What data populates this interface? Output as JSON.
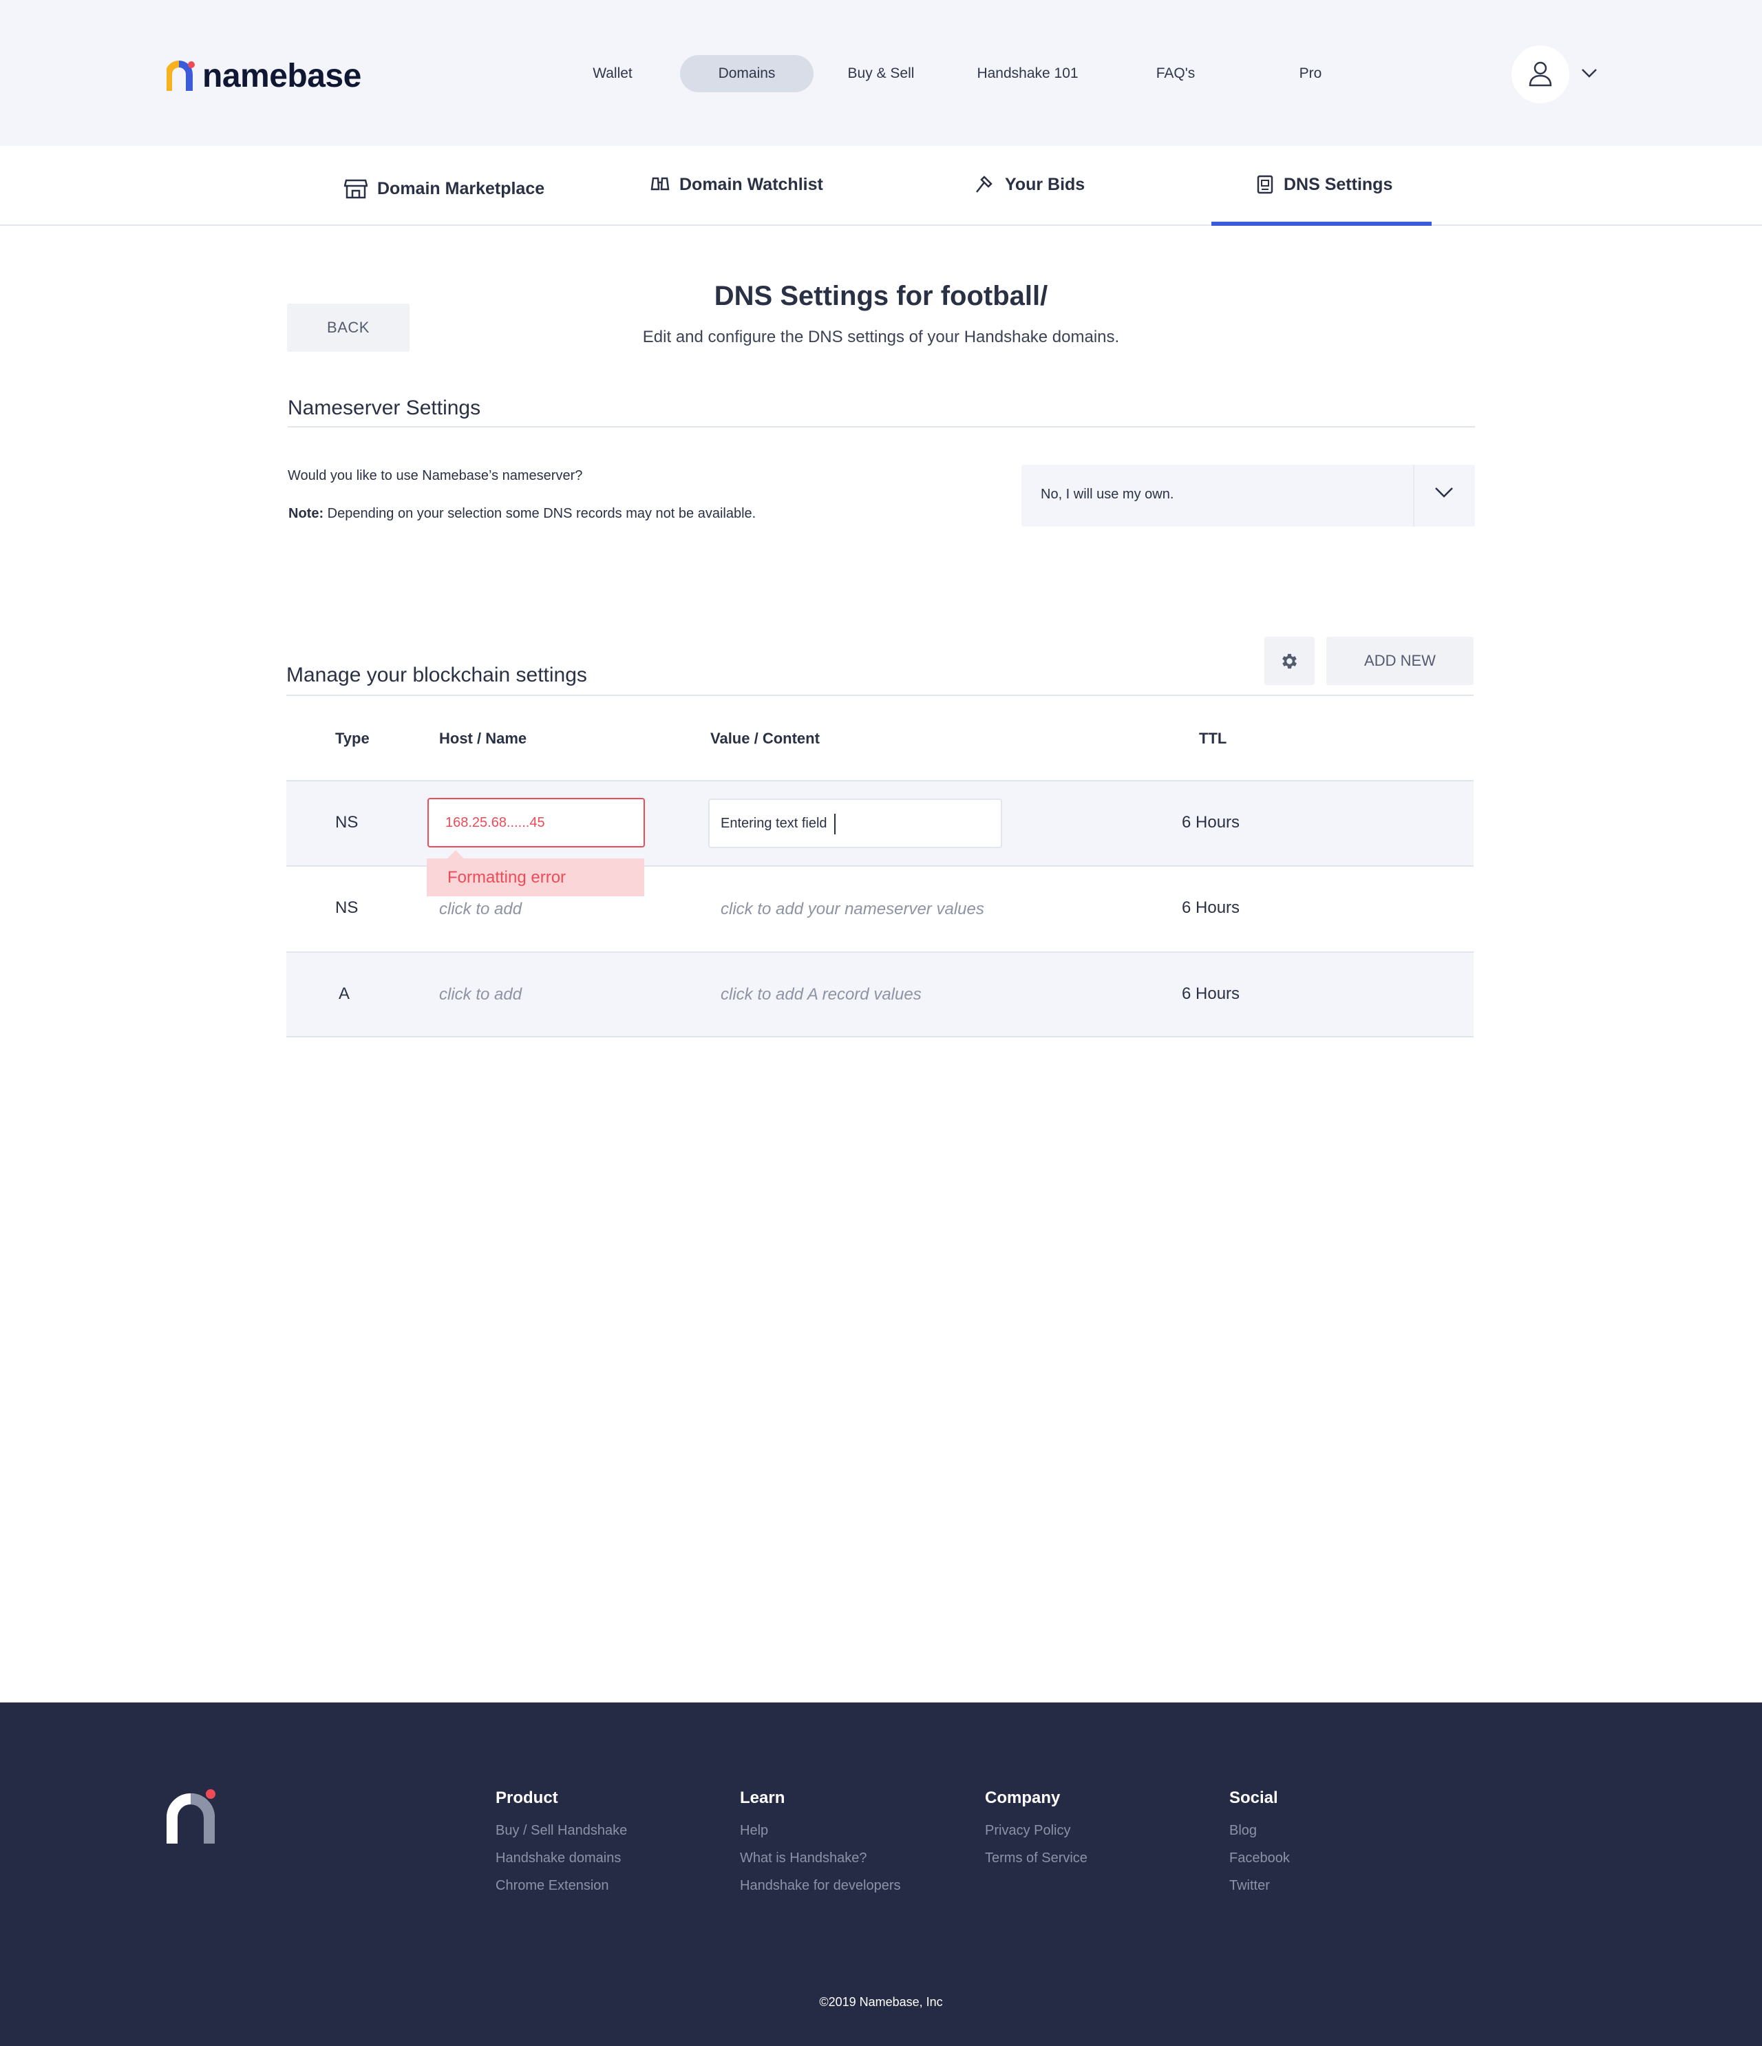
{
  "brand": {
    "name": "namebase"
  },
  "nav": {
    "items": [
      {
        "label": "Wallet"
      },
      {
        "label": "Domains"
      },
      {
        "label": "Buy & Sell"
      },
      {
        "label": "Handshake 101"
      },
      {
        "label": "FAQ's"
      },
      {
        "label": "Pro"
      }
    ],
    "active": "Domains"
  },
  "subtabs": [
    {
      "label": "Domain Marketplace",
      "icon": "storefront-icon"
    },
    {
      "label": "Domain Watchlist",
      "icon": "binoculars-icon"
    },
    {
      "label": "Your Bids",
      "icon": "gavel-icon"
    },
    {
      "label": "DNS Settings",
      "icon": "document-icon"
    }
  ],
  "page": {
    "back_label": "BACK",
    "title": "DNS Settings for football/",
    "subtitle": "Edit and configure the DNS settings of your Handshake domains."
  },
  "nameserver": {
    "section_title": "Nameserver Settings",
    "question": "Would you like to use Namebase’s nameserver?",
    "note_label": "Note:",
    "note_text": " Depending on your selection some DNS records may not be available.",
    "select_value": "No, I will use my own."
  },
  "blockchain": {
    "section_title": "Manage your blockchain settings",
    "add_new_label": "ADD NEW",
    "columns": {
      "type": "Type",
      "host": "Host / Name",
      "value": "Value / Content",
      "ttl": "TTL"
    },
    "rows": [
      {
        "type": "NS",
        "host": "168.25.68......45",
        "value": "Entering text field",
        "ttl": "6 Hours",
        "error": "Formatting error"
      },
      {
        "type": "NS",
        "host": "click to add",
        "value": "click to add your nameserver values",
        "ttl": "6 Hours"
      },
      {
        "type": "A",
        "host": "click to add",
        "value": "click to add A record values",
        "ttl": "6 Hours"
      }
    ]
  },
  "footer": {
    "columns": [
      {
        "title": "Product",
        "links": [
          "Buy / Sell Handshake",
          "Handshake domains",
          "Chrome Extension"
        ]
      },
      {
        "title": "Learn",
        "links": [
          "Help",
          "What is Handshake?",
          "Handshake for developers"
        ]
      },
      {
        "title": "Company",
        "links": [
          "Privacy Policy",
          "Terms of Service"
        ]
      },
      {
        "title": "Social",
        "links": [
          "Blog",
          "Facebook",
          "Twitter"
        ]
      }
    ],
    "copyright": "©2019 Namebase, Inc"
  },
  "colors": {
    "accent": "#3b5bdb",
    "error": "#ef4b57",
    "footer_bg": "#252b45",
    "header_bg": "#f4f5fa"
  }
}
